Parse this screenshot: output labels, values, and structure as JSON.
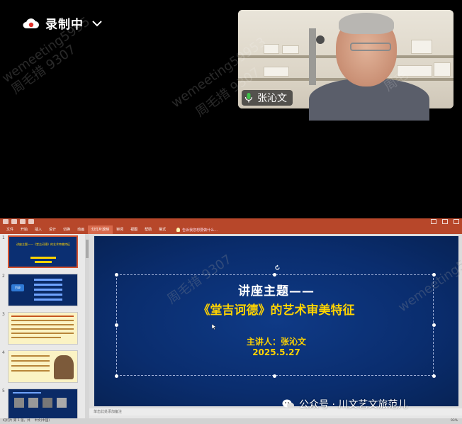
{
  "recording": {
    "label": "录制中"
  },
  "video": {
    "participant_name": "张沁文"
  },
  "watermarks": [
    "wemeeting5995",
    "周毛措 9307",
    "wemeeting59953",
    "周毛措 9307",
    "wemeeting5995",
    "周毛措 9307",
    "wemeeting59953",
    "周毛"
  ],
  "ppt": {
    "ribbon_tabs": [
      "文件",
      "开始",
      "插入",
      "设计",
      "切换",
      "动画",
      "幻灯片放映",
      "审阅",
      "视图",
      "帮助",
      "格式"
    ],
    "active_tab_index": 6,
    "tell_me": "告诉我您想要做什么...",
    "thumbnails": [
      {
        "num": "1",
        "text": "讲座主题——《堂吉诃德》的艺术审美特征"
      },
      {
        "num": "2",
        "text": "目录"
      },
      {
        "num": "3",
        "text": ""
      },
      {
        "num": "4",
        "text": ""
      },
      {
        "num": "5",
        "text": ""
      }
    ],
    "slide": {
      "title": "讲座主题——",
      "subtitle": "《堂吉诃德》的艺术审美特征",
      "presenter": "主讲人：张沁文",
      "date": "2025.5.27"
    },
    "notes_placeholder": "单击此处添加备注",
    "status_left": "幻灯片 第 1 张，共",
    "status_lang": "中文(中国)",
    "zoom": "93%"
  },
  "overlay": {
    "wechat_text": "公众号 · 川文艺文旅范儿"
  },
  "colors": {
    "ppt_accent": "#b7472a",
    "slide_bg": "#0a2d6e",
    "slide_highlight": "#ffd300"
  }
}
